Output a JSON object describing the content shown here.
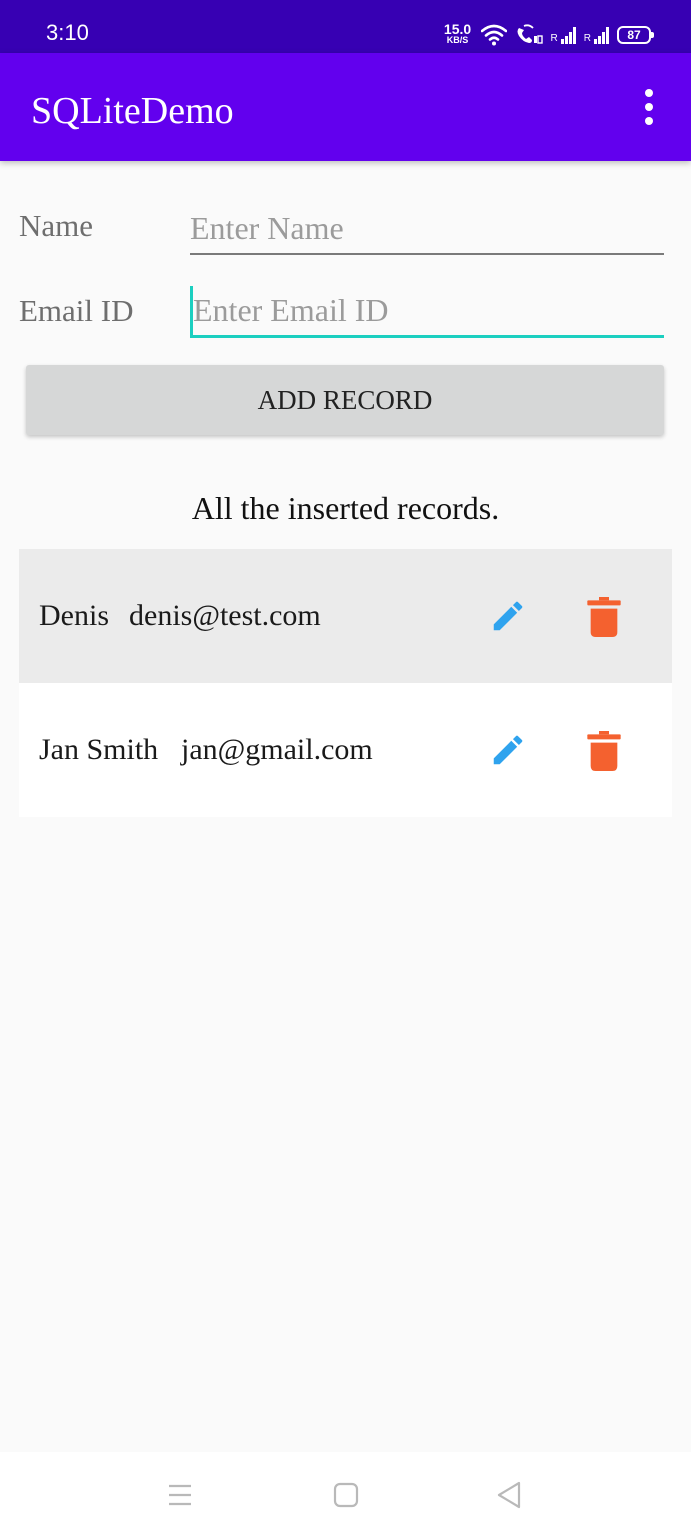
{
  "status_bar": {
    "time": "3:10",
    "net_speed_value": "15.0",
    "net_speed_unit": "KB/S",
    "sim1_label": "R",
    "sim2_label": "R",
    "battery_level": "87"
  },
  "app_bar": {
    "title": "SQLiteDemo"
  },
  "form": {
    "name_label": "Name",
    "name_placeholder": "Enter Name",
    "name_value": "",
    "email_label": "Email ID",
    "email_placeholder": "Enter Email ID",
    "email_value": "",
    "add_button_label": "ADD RECORD"
  },
  "records_heading": "All the inserted records.",
  "records": [
    {
      "name": "Denis",
      "email": "denis@test.com"
    },
    {
      "name": "Jan Smith",
      "email": "jan@gmail.com"
    }
  ],
  "colors": {
    "app_bar": "#6200ee",
    "status_bar": "#3700b3",
    "focus_accent": "#1bcfc0",
    "edit_icon": "#2fa3ee",
    "delete_icon": "#f4612f",
    "row_highlight": "#ebebeb",
    "row_plain": "#ffffff"
  },
  "icons": {
    "overflow": "more-vert-icon",
    "edit": "pencil-icon",
    "delete": "trash-icon",
    "nav_recents": "menu-lines-icon",
    "nav_home": "square-icon",
    "nav_back": "back-triangle-icon"
  }
}
